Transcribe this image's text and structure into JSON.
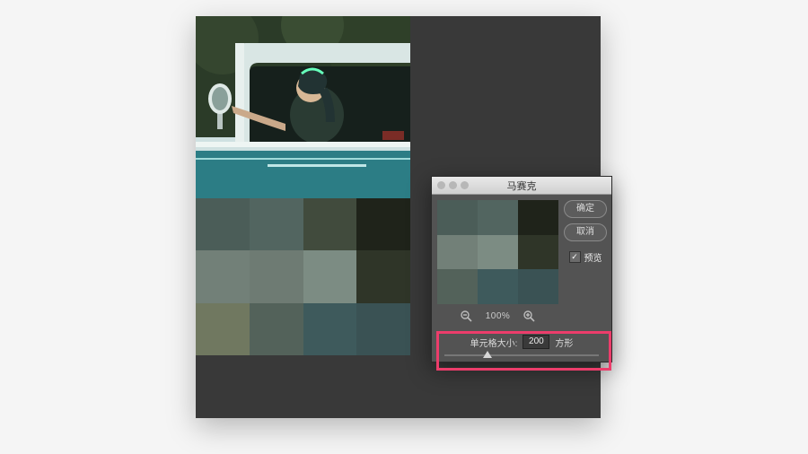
{
  "dialog": {
    "title": "马赛克",
    "ok_label": "确定",
    "cancel_label": "取消",
    "preview_label": "预览",
    "preview_checked": true,
    "zoom_label": "100%",
    "cell_size_label": "单元格大小:",
    "cell_size_value": "200",
    "cell_shape_label": "方形"
  },
  "mosaic_colors": {
    "main": [
      "#4b5d58",
      "#526560",
      "#414b3d",
      "#1f231a",
      "#728078",
      "#6e7b73",
      "#7c8c83",
      "#2f3528",
      "#707860",
      "#53625a",
      "#3e5a5c",
      "#3a5254"
    ],
    "preview": [
      "#4b5d58",
      "#526560",
      "#1f231a",
      "#728078",
      "#7c8c83",
      "#2f3528",
      "#53625a",
      "#3e5a5c",
      "#3a5254"
    ]
  }
}
